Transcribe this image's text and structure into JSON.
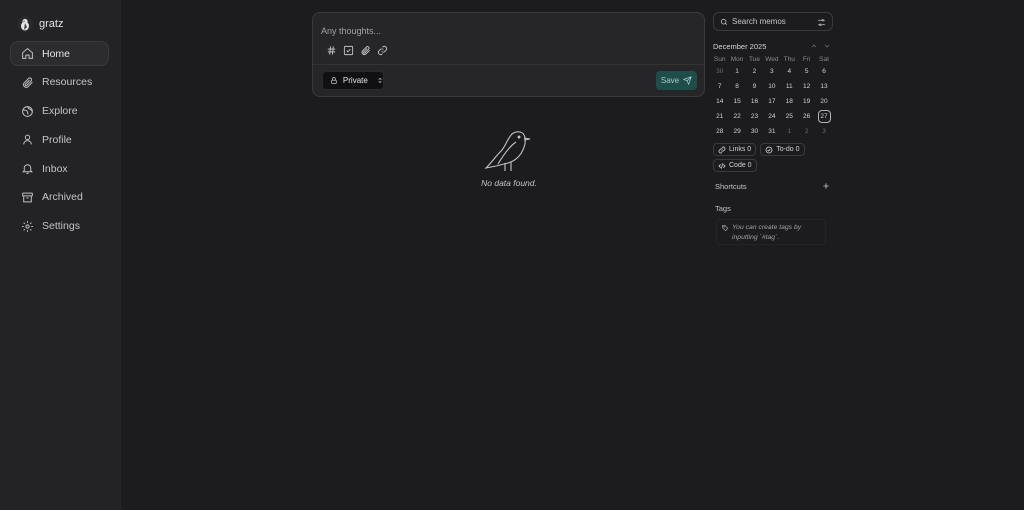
{
  "sidebar": {
    "user": {
      "name": "gratz"
    },
    "items": [
      {
        "label": "Home",
        "icon": "home-icon",
        "active": true
      },
      {
        "label": "Resources",
        "icon": "paperclip-icon",
        "active": false
      },
      {
        "label": "Explore",
        "icon": "globe-icon",
        "active": false
      },
      {
        "label": "Profile",
        "icon": "user-icon",
        "active": false
      },
      {
        "label": "Inbox",
        "icon": "bell-icon",
        "active": false
      },
      {
        "label": "Archived",
        "icon": "archive-icon",
        "active": false
      },
      {
        "label": "Settings",
        "icon": "gear-icon",
        "active": false
      }
    ]
  },
  "editor": {
    "placeholder": "Any thoughts...",
    "tools": [
      "hash-icon",
      "checkbox-icon",
      "paperclip-icon",
      "link-icon"
    ],
    "visibility": "Private",
    "save_label": "Save"
  },
  "empty_state": {
    "text": "No data found."
  },
  "search": {
    "placeholder": "Search memos"
  },
  "calendar": {
    "title": "December 2025",
    "weekdays": [
      "Sun",
      "Mon",
      "Tue",
      "Wed",
      "Thu",
      "Fri",
      "Sat"
    ],
    "weeks": [
      [
        "30",
        "1",
        "2",
        "3",
        "4",
        "5",
        "6"
      ],
      [
        "7",
        "8",
        "9",
        "10",
        "11",
        "12",
        "13"
      ],
      [
        "14",
        "15",
        "16",
        "17",
        "18",
        "19",
        "20"
      ],
      [
        "21",
        "22",
        "23",
        "24",
        "25",
        "26",
        "27"
      ],
      [
        "28",
        "29",
        "30",
        "31",
        "1",
        "2",
        "3"
      ]
    ],
    "today": "27"
  },
  "stats": {
    "links": "Links 0",
    "todo": "To-do 0",
    "code": "Code 0"
  },
  "shortcuts": {
    "title": "Shortcuts"
  },
  "tags": {
    "title": "Tags",
    "hint": "You can create tags by inputting `#tag`."
  },
  "colors": {
    "background": "#1c1c1e",
    "sidebar": "#232326",
    "accent": "#1e4d4a"
  }
}
